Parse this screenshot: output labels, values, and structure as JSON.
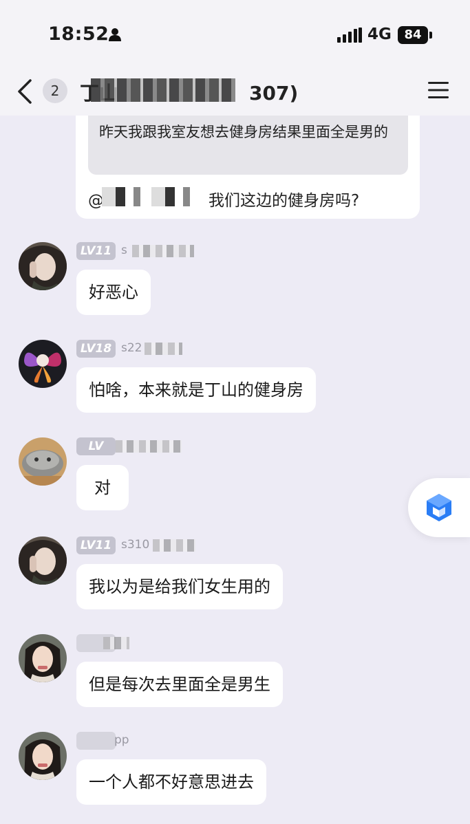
{
  "status_bar": {
    "time": "18:52",
    "network": "4G",
    "battery": "84"
  },
  "header": {
    "unread_count": "2",
    "title": "丁山",
    "title_suffix": "307)"
  },
  "quoted_message": {
    "quote_text": "昨天我跟我室友想去健身房结果里面全是男的",
    "mention_prefix": "@",
    "mention_text": "我们这边的健身房吗?"
  },
  "messages": [
    {
      "level": "LV11",
      "nickname": "s",
      "text": "好恶心",
      "avatar": "avatar-girl-dark"
    },
    {
      "level": "LV18",
      "nickname": "s22",
      "text": "怕啥，本来就是丁山的健身房",
      "avatar": "avatar-butterfly"
    },
    {
      "level": "LV",
      "nickname": "",
      "text": "对",
      "avatar": "avatar-cat"
    },
    {
      "level": "LV11",
      "nickname": "s310",
      "text": "我以为是给我们女生用的",
      "avatar": "avatar-girl-dark"
    },
    {
      "level": "",
      "nickname": "",
      "text": "但是每次去里面全是男生",
      "avatar": "avatar-girl-portrait"
    },
    {
      "level": "",
      "nickname": "pp",
      "text": "一个人都不好意思进去",
      "avatar": "avatar-girl-portrait"
    }
  ],
  "colors": {
    "background": "#edebf5",
    "bubble": "#ffffff",
    "badge": "#c4c3cf",
    "float_icon": "#2a7df5"
  }
}
